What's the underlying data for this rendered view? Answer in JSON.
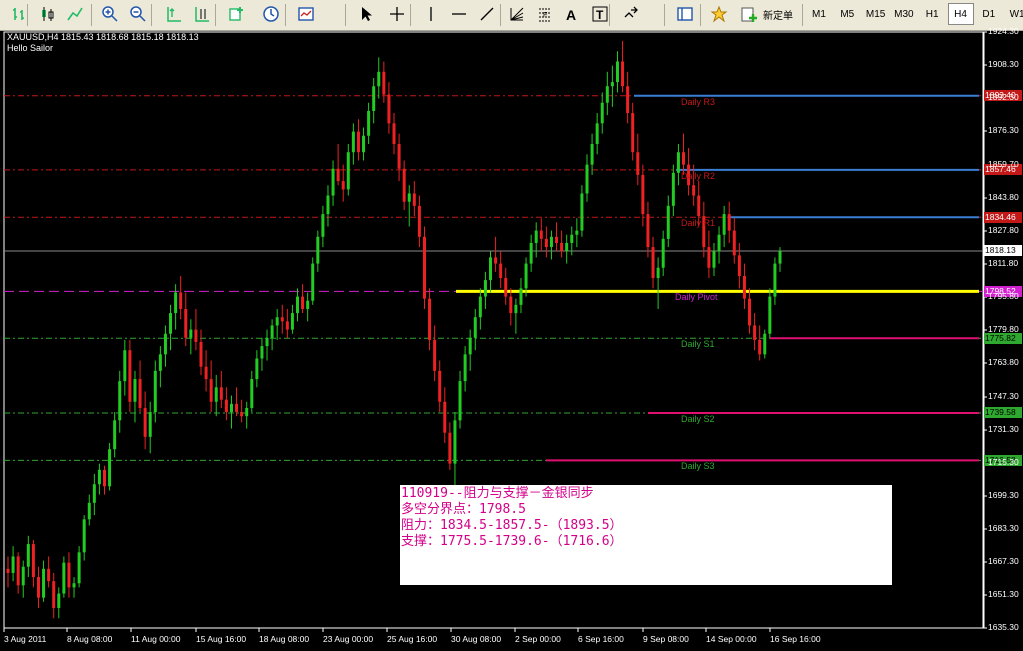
{
  "toolbar": {
    "icons": [
      "bar-chart-icon",
      "candlestick-icon",
      "line-chart-icon",
      "zoom-in-icon",
      "zoom-out-icon",
      "auto-scroll-icon",
      "chart-shift-icon",
      "indicators-icon",
      "periods-icon",
      "templates-icon",
      "cursor-icon",
      "crosshair-icon",
      "vertical-line-icon",
      "horizontal-line-icon",
      "trendline-icon",
      "fibonacci-fan-icon",
      "fibonacci-icon",
      "text-icon",
      "text-label-icon",
      "arrows-icon",
      "navigator-icon",
      "expert-advisors-icon",
      "new-order-icon"
    ],
    "new_order_label": "新定单",
    "timeframes": [
      "M1",
      "M5",
      "M15",
      "M30",
      "H1",
      "H4",
      "D1",
      "W1"
    ],
    "active_timeframe": "H4"
  },
  "chart_info": {
    "header": "XAUUSD,H4  1815.43 1818.68 1815.18 1818.13",
    "expert": "Hello Sailor"
  },
  "chart_data": {
    "type": "candlestick",
    "symbol": "XAUUSD",
    "timeframe": "H4",
    "ylim": [
      1635.3,
      1924.3
    ],
    "y_ticks": [
      "1924.30",
      "1908.30",
      "1892.30",
      "1876.30",
      "1859.70",
      "1843.80",
      "1827.80",
      "1811.80",
      "1795.80",
      "1779.80",
      "1763.80",
      "1747.30",
      "1731.30",
      "1715.30",
      "1699.30",
      "1683.30",
      "1667.30",
      "1651.30",
      "1635.30"
    ],
    "x_ticks": [
      "3 Aug 2011",
      "8 Aug 08:00",
      "11 Aug 00:00",
      "15 Aug 16:00",
      "18 Aug 08:00",
      "23 Aug 00:00",
      "25 Aug 16:00",
      "30 Aug 08:00",
      "2 Sep 00:00",
      "6 Sep 16:00",
      "9 Sep 08:00",
      "14 Sep 00:00",
      "16 Sep 16:00"
    ],
    "current_price": "1818.13",
    "levels": [
      {
        "name": "Daily R3",
        "price": "1893.40",
        "color": "#3a7fd5"
      },
      {
        "name": "Daily R2",
        "price": "1857.46",
        "color": "#3a7fd5"
      },
      {
        "name": "Daily R1",
        "price": "1834.46",
        "color": "#3a7fd5"
      },
      {
        "name": "Daily Pivot",
        "price": "1798.52",
        "color": "#ffff00"
      },
      {
        "name": "Daily S1",
        "price": "1775.82",
        "color": "#e01070"
      },
      {
        "name": "Daily S2",
        "price": "1739.58",
        "color": "#e01070"
      },
      {
        "name": "Daily S3",
        "price": "1716.58",
        "color": "#e01070"
      }
    ],
    "candles": [
      [
        1664,
        1670,
        1655,
        1662
      ],
      [
        1662,
        1675,
        1658,
        1670
      ],
      [
        1670,
        1672,
        1652,
        1656
      ],
      [
        1656,
        1668,
        1650,
        1665
      ],
      [
        1665,
        1680,
        1660,
        1676
      ],
      [
        1676,
        1678,
        1655,
        1660
      ],
      [
        1660,
        1665,
        1645,
        1650
      ],
      [
        1650,
        1668,
        1648,
        1664
      ],
      [
        1664,
        1670,
        1655,
        1658
      ],
      [
        1658,
        1662,
        1640,
        1645
      ],
      [
        1645,
        1655,
        1640,
        1652
      ],
      [
        1652,
        1670,
        1650,
        1667
      ],
      [
        1667,
        1672,
        1650,
        1655
      ],
      [
        1655,
        1660,
        1650,
        1657
      ],
      [
        1657,
        1675,
        1655,
        1672
      ],
      [
        1672,
        1690,
        1668,
        1688
      ],
      [
        1688,
        1700,
        1685,
        1696
      ],
      [
        1696,
        1710,
        1690,
        1705
      ],
      [
        1705,
        1715,
        1700,
        1712
      ],
      [
        1712,
        1714,
        1700,
        1704
      ],
      [
        1704,
        1725,
        1702,
        1722
      ],
      [
        1722,
        1740,
        1718,
        1736
      ],
      [
        1736,
        1760,
        1730,
        1755
      ],
      [
        1755,
        1775,
        1748,
        1770
      ],
      [
        1770,
        1775,
        1740,
        1745
      ],
      [
        1745,
        1760,
        1735,
        1756
      ],
      [
        1756,
        1765,
        1740,
        1742
      ],
      [
        1742,
        1750,
        1722,
        1728
      ],
      [
        1728,
        1745,
        1720,
        1740
      ],
      [
        1740,
        1765,
        1735,
        1760
      ],
      [
        1760,
        1772,
        1752,
        1768
      ],
      [
        1768,
        1782,
        1762,
        1778
      ],
      [
        1778,
        1792,
        1770,
        1788
      ],
      [
        1788,
        1802,
        1780,
        1798
      ],
      [
        1798,
        1806,
        1785,
        1790
      ],
      [
        1790,
        1798,
        1772,
        1776
      ],
      [
        1776,
        1785,
        1768,
        1780
      ],
      [
        1780,
        1790,
        1770,
        1774
      ],
      [
        1774,
        1780,
        1758,
        1762
      ],
      [
        1762,
        1770,
        1750,
        1756
      ],
      [
        1756,
        1765,
        1740,
        1745
      ],
      [
        1745,
        1758,
        1738,
        1752
      ],
      [
        1752,
        1760,
        1742,
        1746
      ],
      [
        1746,
        1752,
        1736,
        1740
      ],
      [
        1740,
        1748,
        1732,
        1744
      ],
      [
        1744,
        1752,
        1738,
        1740
      ],
      [
        1740,
        1746,
        1735,
        1738
      ],
      [
        1738,
        1745,
        1732,
        1742
      ],
      [
        1742,
        1760,
        1740,
        1756
      ],
      [
        1756,
        1770,
        1752,
        1766
      ],
      [
        1766,
        1776,
        1760,
        1772
      ],
      [
        1772,
        1780,
        1765,
        1776
      ],
      [
        1776,
        1785,
        1770,
        1782
      ],
      [
        1782,
        1790,
        1775,
        1786
      ],
      [
        1786,
        1792,
        1778,
        1784
      ],
      [
        1784,
        1790,
        1776,
        1780
      ],
      [
        1780,
        1792,
        1778,
        1788
      ],
      [
        1788,
        1800,
        1784,
        1796
      ],
      [
        1796,
        1802,
        1788,
        1790
      ],
      [
        1790,
        1798,
        1784,
        1794
      ],
      [
        1794,
        1815,
        1792,
        1812
      ],
      [
        1812,
        1828,
        1808,
        1825
      ],
      [
        1825,
        1840,
        1820,
        1836
      ],
      [
        1836,
        1850,
        1830,
        1845
      ],
      [
        1845,
        1862,
        1840,
        1858
      ],
      [
        1858,
        1870,
        1850,
        1852
      ],
      [
        1852,
        1860,
        1842,
        1848
      ],
      [
        1848,
        1870,
        1845,
        1866
      ],
      [
        1866,
        1880,
        1860,
        1876
      ],
      [
        1876,
        1882,
        1862,
        1866
      ],
      [
        1866,
        1878,
        1862,
        1874
      ],
      [
        1874,
        1890,
        1870,
        1886
      ],
      [
        1886,
        1902,
        1880,
        1898
      ],
      [
        1898,
        1912,
        1892,
        1905
      ],
      [
        1905,
        1910,
        1890,
        1894
      ],
      [
        1894,
        1900,
        1875,
        1880
      ],
      [
        1880,
        1885,
        1865,
        1870
      ],
      [
        1870,
        1875,
        1852,
        1858
      ],
      [
        1858,
        1862,
        1838,
        1842
      ],
      [
        1842,
        1850,
        1830,
        1846
      ],
      [
        1846,
        1852,
        1835,
        1840
      ],
      [
        1840,
        1845,
        1820,
        1825
      ],
      [
        1825,
        1830,
        1790,
        1795
      ],
      [
        1795,
        1800,
        1770,
        1775
      ],
      [
        1775,
        1782,
        1755,
        1760
      ],
      [
        1760,
        1765,
        1740,
        1745
      ],
      [
        1745,
        1752,
        1725,
        1730
      ],
      [
        1730,
        1735,
        1712,
        1715
      ],
      [
        1715,
        1740,
        1702,
        1736
      ],
      [
        1736,
        1760,
        1732,
        1755
      ],
      [
        1755,
        1772,
        1750,
        1768
      ],
      [
        1768,
        1780,
        1760,
        1776
      ],
      [
        1776,
        1790,
        1770,
        1786
      ],
      [
        1786,
        1800,
        1780,
        1796
      ],
      [
        1796,
        1808,
        1790,
        1804
      ],
      [
        1804,
        1818,
        1798,
        1815
      ],
      [
        1815,
        1825,
        1808,
        1812
      ],
      [
        1812,
        1818,
        1800,
        1805
      ],
      [
        1805,
        1810,
        1792,
        1796
      ],
      [
        1796,
        1800,
        1782,
        1788
      ],
      [
        1788,
        1795,
        1778,
        1792
      ],
      [
        1792,
        1805,
        1788,
        1800
      ],
      [
        1800,
        1815,
        1796,
        1812
      ],
      [
        1812,
        1826,
        1808,
        1822
      ],
      [
        1822,
        1832,
        1815,
        1828
      ],
      [
        1828,
        1834,
        1818,
        1824
      ],
      [
        1824,
        1830,
        1815,
        1820
      ],
      [
        1820,
        1828,
        1814,
        1825
      ],
      [
        1825,
        1832,
        1818,
        1822
      ],
      [
        1822,
        1828,
        1815,
        1818
      ],
      [
        1818,
        1826,
        1812,
        1822
      ],
      [
        1822,
        1830,
        1816,
        1826
      ],
      [
        1826,
        1834,
        1820,
        1828
      ],
      [
        1828,
        1850,
        1825,
        1846
      ],
      [
        1846,
        1865,
        1842,
        1860
      ],
      [
        1860,
        1875,
        1855,
        1870
      ],
      [
        1870,
        1885,
        1865,
        1880
      ],
      [
        1880,
        1895,
        1875,
        1890
      ],
      [
        1890,
        1905,
        1884,
        1898
      ],
      [
        1898,
        1908,
        1888,
        1900
      ],
      [
        1900,
        1915,
        1895,
        1910
      ],
      [
        1910,
        1920,
        1895,
        1898
      ],
      [
        1898,
        1905,
        1880,
        1885
      ],
      [
        1885,
        1890,
        1862,
        1866
      ],
      [
        1866,
        1875,
        1850,
        1855
      ],
      [
        1855,
        1860,
        1830,
        1836
      ],
      [
        1836,
        1842,
        1815,
        1820
      ],
      [
        1820,
        1825,
        1800,
        1805
      ],
      [
        1805,
        1815,
        1790,
        1810
      ],
      [
        1810,
        1828,
        1806,
        1824
      ],
      [
        1824,
        1845,
        1820,
        1840
      ],
      [
        1840,
        1860,
        1835,
        1856
      ],
      [
        1856,
        1870,
        1850,
        1866
      ],
      [
        1866,
        1875,
        1855,
        1860
      ],
      [
        1860,
        1868,
        1845,
        1850
      ],
      [
        1850,
        1860,
        1840,
        1845
      ],
      [
        1845,
        1852,
        1830,
        1835
      ],
      [
        1835,
        1842,
        1815,
        1820
      ],
      [
        1820,
        1828,
        1805,
        1810
      ],
      [
        1810,
        1822,
        1806,
        1818
      ],
      [
        1818,
        1830,
        1812,
        1826
      ],
      [
        1826,
        1840,
        1820,
        1836
      ],
      [
        1836,
        1842,
        1822,
        1828
      ],
      [
        1828,
        1834,
        1812,
        1816
      ],
      [
        1816,
        1822,
        1800,
        1806
      ],
      [
        1806,
        1812,
        1790,
        1795
      ],
      [
        1795,
        1800,
        1778,
        1782
      ],
      [
        1782,
        1788,
        1770,
        1775
      ],
      [
        1775,
        1782,
        1765,
        1768
      ],
      [
        1768,
        1780,
        1766,
        1778
      ],
      [
        1778,
        1800,
        1776,
        1796
      ],
      [
        1796,
        1815,
        1792,
        1812
      ],
      [
        1812,
        1820,
        1808,
        1818
      ]
    ]
  },
  "note": {
    "line1": "110919--阻力与支撑－金银同步",
    "line2": "多空分界点：1798.5",
    "line3": "阻力：1834.5-1857.5-（1893.5）",
    "line4": "支撑：1775.5-1739.6-（1716.6）"
  }
}
